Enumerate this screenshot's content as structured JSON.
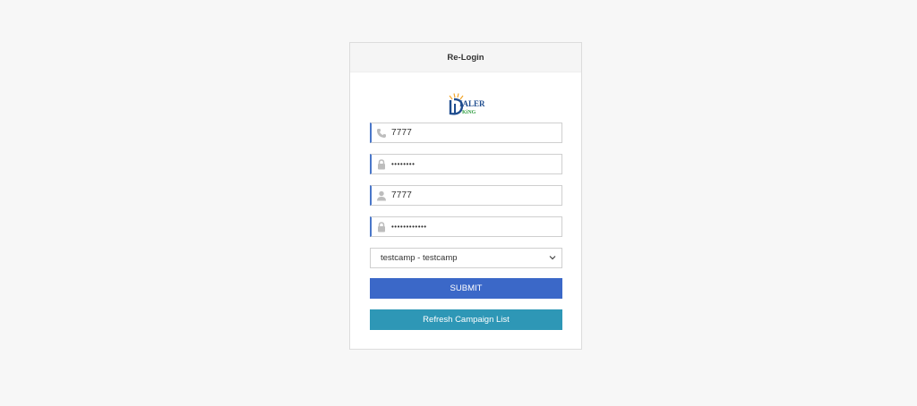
{
  "header": {
    "title": "Re-Login"
  },
  "logo": {
    "text_main": "IALER",
    "text_sub": "KiNG"
  },
  "fields": [
    {
      "name": "phone",
      "icon": "phone-icon",
      "value": "7777"
    },
    {
      "name": "phone-password",
      "icon": "lock-icon",
      "value": "••••••••"
    },
    {
      "name": "user",
      "icon": "user-icon",
      "value": "7777"
    },
    {
      "name": "user-password",
      "icon": "lock-icon",
      "value": "••••••••••••"
    }
  ],
  "campaign_select": {
    "value": "testcamp - testcamp"
  },
  "buttons": {
    "submit": "SUBMIT",
    "refresh": "Refresh Campaign List"
  },
  "colors": {
    "submit": "#3b68c8",
    "refresh": "#2e97b6",
    "field_accent": "#4a77c9",
    "logo_blue": "#1f4d8f",
    "logo_green": "#3aa34a",
    "logo_sun": "#f2a428"
  }
}
